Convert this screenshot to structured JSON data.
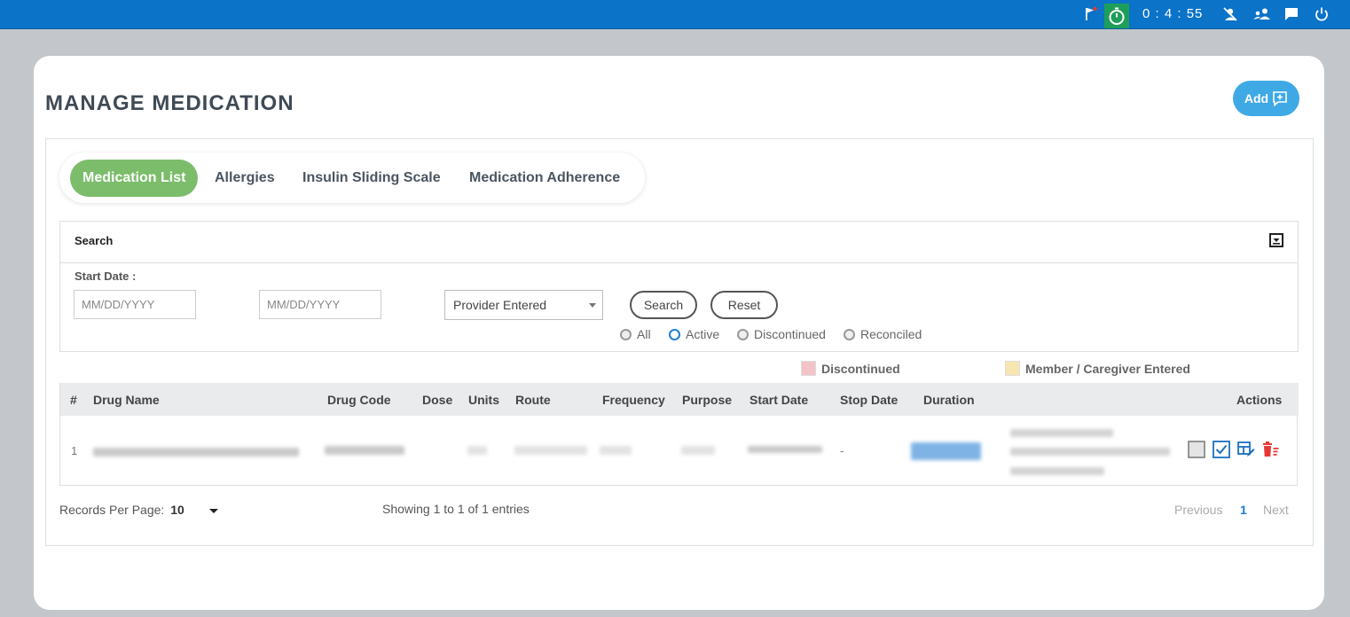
{
  "topbar": {
    "timer": "0 : 4 : 55",
    "icons": [
      "flag-icon",
      "stopwatch-icon",
      "user-off-icon",
      "user-group-icon",
      "chat-icon",
      "power-icon"
    ],
    "colors": {
      "bar": "#0b73c8",
      "timer_bg": "#1f9e5a"
    }
  },
  "page": {
    "title": "MANAGE MEDICATION",
    "add_label": "Add"
  },
  "tabs": [
    {
      "label": "Medication List",
      "active": true
    },
    {
      "label": "Allergies",
      "active": false
    },
    {
      "label": "Insulin Sliding Scale",
      "active": false
    },
    {
      "label": "Medication Adherence",
      "active": false
    }
  ],
  "search": {
    "title": "Search",
    "start_date_label": "Start Date :",
    "from_placeholder": "MM/DD/YYYY",
    "to_placeholder": "MM/DD/YYYY",
    "source_select": "Provider Entered",
    "search_button": "Search",
    "reset_button": "Reset",
    "status_options": [
      {
        "label": "All",
        "checked": false
      },
      {
        "label": "Active",
        "checked": true
      },
      {
        "label": "Discontinued",
        "checked": false
      },
      {
        "label": "Reconciled",
        "checked": false
      }
    ]
  },
  "legend": [
    {
      "label": "Discontinued",
      "color": "#f2c4c8"
    },
    {
      "label": "Member / Caregiver Entered",
      "color": "#f7e6b0"
    }
  ],
  "table": {
    "columns": [
      "#",
      "Drug Name",
      "Drug Code",
      "Dose",
      "Units",
      "Route",
      "Frequency",
      "Purpose",
      "Start Date",
      "Stop Date",
      "Duration",
      "Actions"
    ],
    "rows": [
      {
        "index": "1",
        "stop_date": "-"
      }
    ]
  },
  "footer": {
    "records_label": "Records Per Page:",
    "records_value": "10",
    "showing": "Showing 1 to 1 of 1 entries",
    "previous": "Previous",
    "page": "1",
    "next": "Next"
  }
}
